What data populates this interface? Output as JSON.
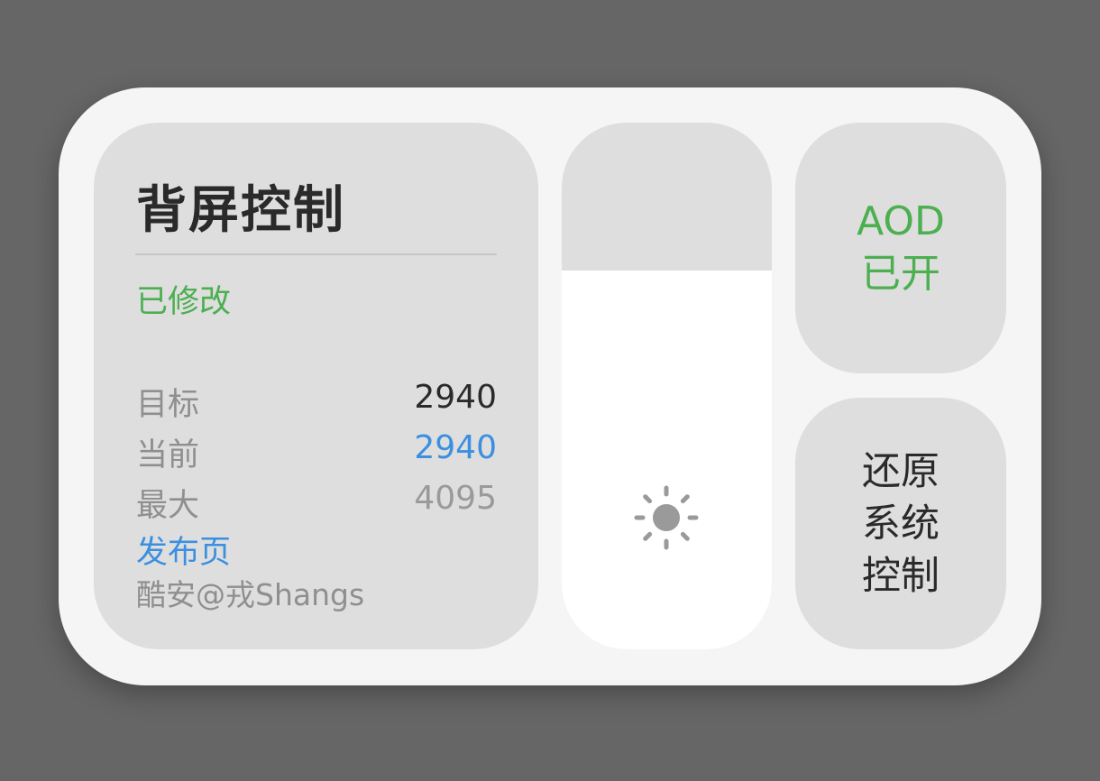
{
  "info_panel": {
    "title": "背屏控制",
    "status": "已修改",
    "rows": [
      {
        "label": "目标",
        "value": "2940"
      },
      {
        "label": "当前",
        "value": "2940"
      },
      {
        "label": "最大",
        "value": "4095"
      }
    ],
    "link_label": "发布页",
    "author": "酷安@戎Shangs"
  },
  "brightness_slider": {
    "icon": "sun-icon",
    "level_fraction": 0.72
  },
  "aod_button": {
    "label": "AOD\n已开"
  },
  "restore_button": {
    "label": "还原\n系统\n控制"
  },
  "colors": {
    "status_green": "#4caf50",
    "link_blue": "#3b8fe0",
    "panel_gray": "#dedede",
    "widget_bg": "#f5f5f5",
    "page_bg": "#666666"
  }
}
